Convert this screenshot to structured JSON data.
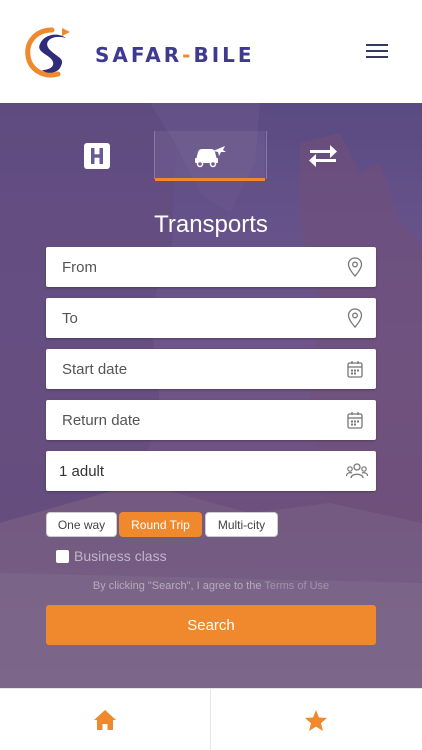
{
  "header": {
    "brand_main": "SAFAR",
    "brand_dash": "-",
    "brand_end": "BILE",
    "logo_icon": "safar-bile-logo",
    "menu_icon": "hamburger-icon"
  },
  "tabs": [
    {
      "icon": "hotel-icon",
      "active": false
    },
    {
      "icon": "transport-icon",
      "active": true
    },
    {
      "icon": "swap-arrows-icon",
      "active": false
    }
  ],
  "title": "Transports",
  "form": {
    "from_placeholder": "From",
    "to_placeholder": "To",
    "start_placeholder": "Start date",
    "return_placeholder": "Return date",
    "passengers_value": "1 adult"
  },
  "trip_types": {
    "one_way": "One way",
    "round_trip": "Round Trip",
    "multi_city": "Multi-city",
    "selected": "Round Trip"
  },
  "business_class_label": "Business class",
  "terms": {
    "prefix": "By clicking \"Search\", I agree to the",
    "link": "Terms of Use"
  },
  "search_label": "Search",
  "bottom_nav": {
    "home_icon": "home-icon",
    "favorites_icon": "star-icon"
  },
  "colors": {
    "accent": "#f0892d",
    "brand": "#3d3a8f",
    "hero_overlay": "#564a8c"
  }
}
